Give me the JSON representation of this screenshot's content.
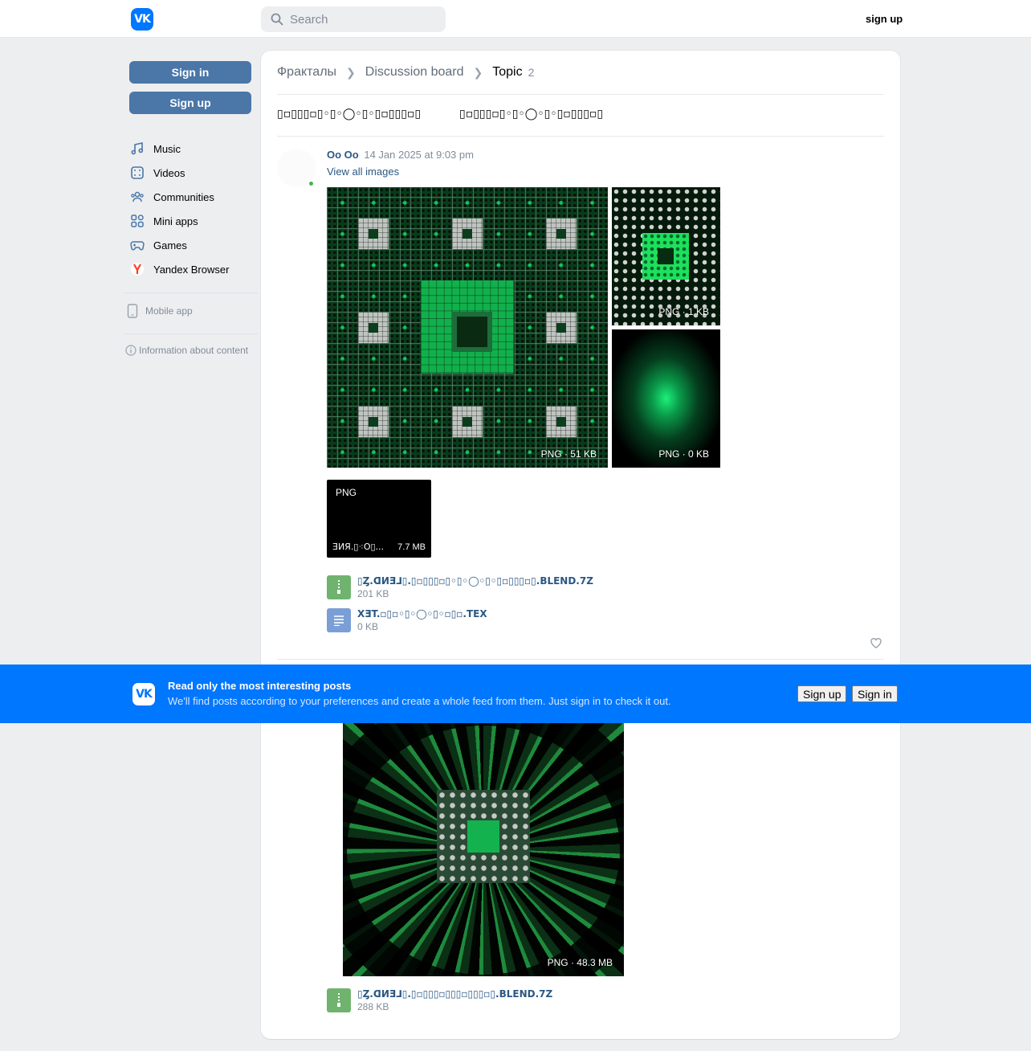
{
  "header": {
    "logo": "VK",
    "search_placeholder": "Search",
    "signup_label": "sign up"
  },
  "sidebar": {
    "sign_in": "Sign in",
    "sign_up": "Sign up",
    "items": [
      {
        "label": "Music",
        "icon": "music-icon"
      },
      {
        "label": "Videos",
        "icon": "video-icon"
      },
      {
        "label": "Communities",
        "icon": "users-icon"
      },
      {
        "label": "Mini apps",
        "icon": "apps-icon"
      },
      {
        "label": "Games",
        "icon": "gamepad-icon"
      },
      {
        "label": "Yandex Browser",
        "icon": "yandex-icon"
      }
    ],
    "mobile_app": "Mobile app",
    "info": "Information about content"
  },
  "breadcrumb": {
    "items": [
      "Фракталы",
      "Discussion board",
      "Topic"
    ],
    "count": "2"
  },
  "topic": {
    "title_left": "▯▫▯▯▯▫▯◦▯◦◯◦▯◦▯▫▯▯▯▫▯",
    "title_right": "▯▫▯▯▯▫▯◦▯◦◯◦▯◦▯▫▯▯▯▫▯"
  },
  "post1": {
    "author": "Oo Oo",
    "date": "14 Jan 2025 at 9:03 pm",
    "view_all": "View all images",
    "images": [
      {
        "tag": "PNG · 51 KB"
      },
      {
        "tag": "PNG · 1 KB"
      },
      {
        "tag": "PNG · 0 KB"
      }
    ],
    "doc": {
      "ext": "PNG",
      "name": "ƎИЯ.▯⁖O▯...",
      "size": "7.7 MB"
    },
    "attachments": [
      {
        "name": "▯Ȥ.ᗡИƎ⅃▯.▯▫▯▯▯▫▯◦▯◦◯◦▯◦▯▫▯▯▯▫▯.BLEND.7Z",
        "size": "201 KB",
        "icon": "archive-icon",
        "color": "#6fb36f"
      },
      {
        "name": "XƎT.▫▯▫◦▯◦◯◦▯◦▫▯▫.TEX",
        "size": "0 KB",
        "icon": "text-file-icon",
        "color": "#7a9fd6"
      }
    ]
  },
  "post2": {
    "image_tag": "PNG · 48.3 MB",
    "attachment": {
      "name": "▯Ȥ.ᗡИƎ⅃▯.▯▫▯▯▯▫▯▯▯▫▯▯▯▫▯.BLEND.7Z",
      "size": "288 KB",
      "icon": "archive-icon",
      "color": "#6fb36f"
    }
  },
  "promo": {
    "title": "Read only the most interesting posts",
    "text": "We'll find posts according to your preferences and create a whole feed from them. Just sign in to check it out.",
    "sign_up": "Sign up",
    "sign_in": "Sign in",
    "accent": "#0077ff"
  }
}
